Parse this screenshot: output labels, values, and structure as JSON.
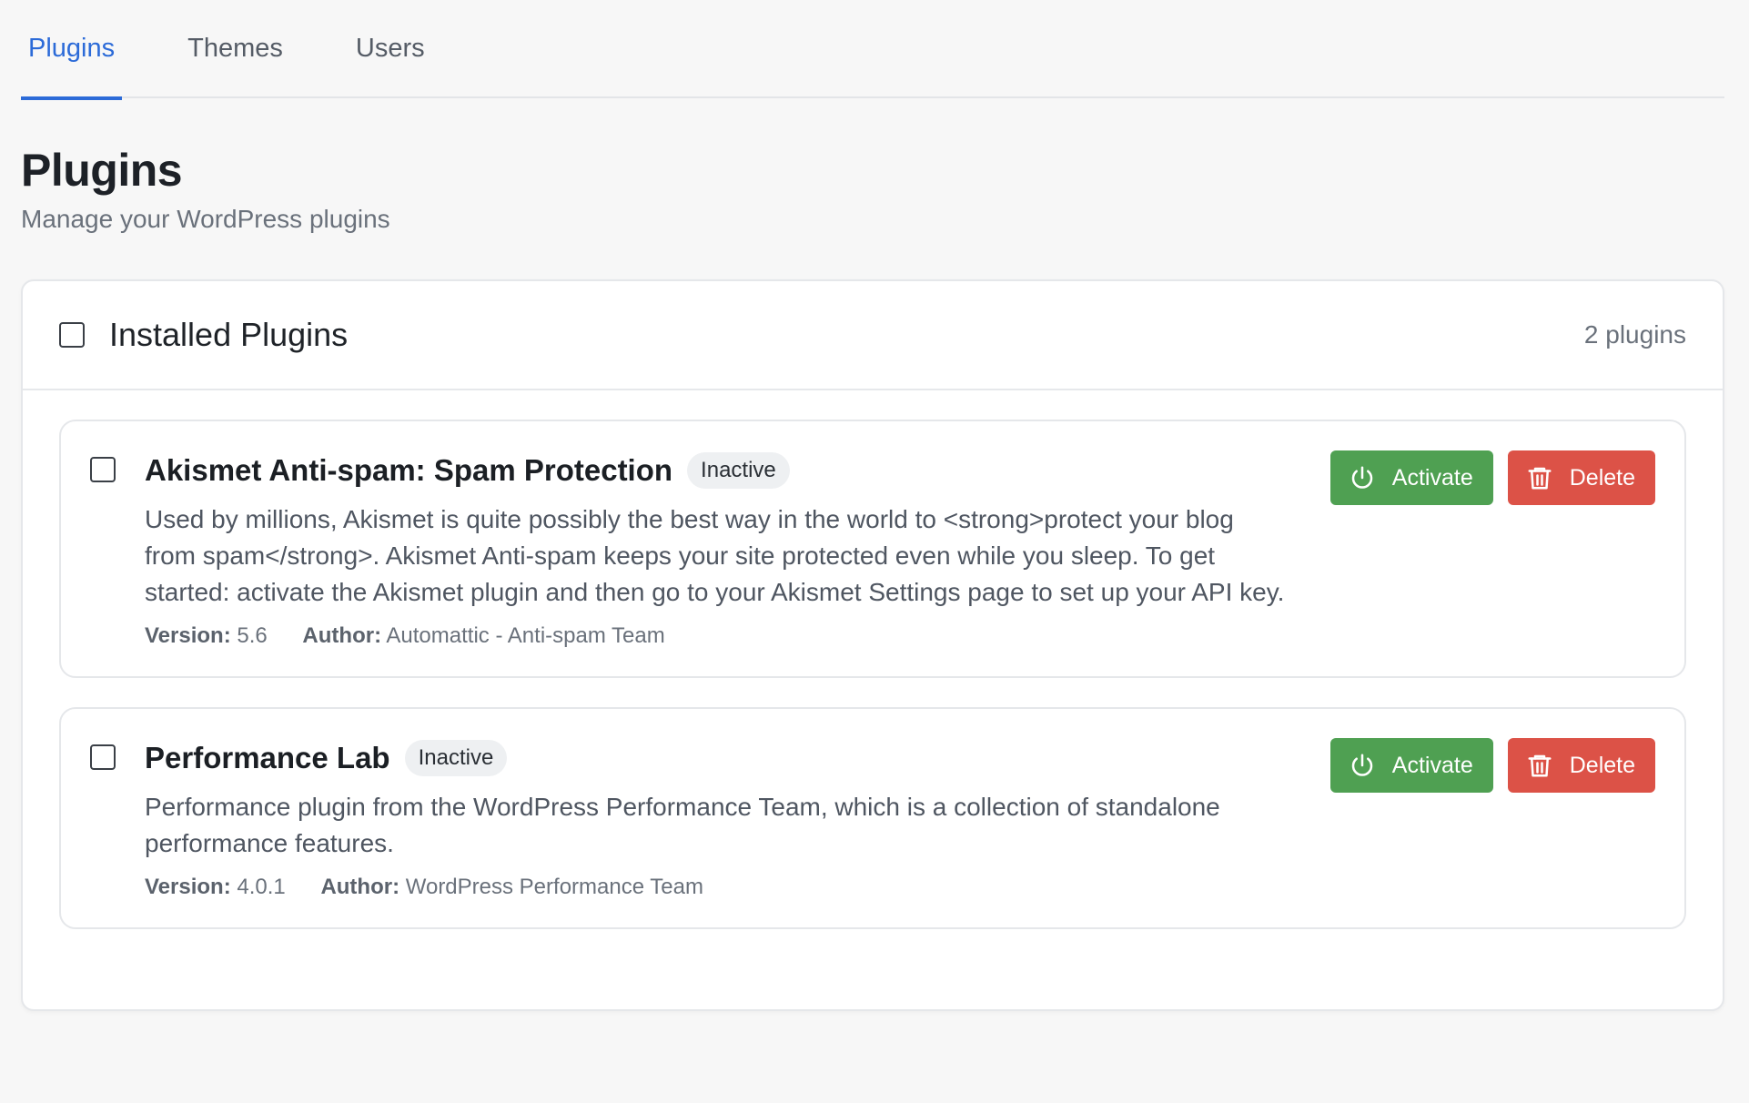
{
  "tabs": [
    {
      "label": "Plugins",
      "active": true
    },
    {
      "label": "Themes",
      "active": false
    },
    {
      "label": "Users",
      "active": false
    }
  ],
  "header": {
    "title": "Plugins",
    "subtitle": "Manage your WordPress plugins"
  },
  "card": {
    "title": "Installed Plugins",
    "count": "2 plugins"
  },
  "labels": {
    "version": "Version:",
    "author": "Author:",
    "activate": "Activate",
    "delete": "Delete"
  },
  "plugins": [
    {
      "name": "Akismet Anti-spam: Spam Protection",
      "status": "Inactive",
      "description": "Used by millions, Akismet is quite possibly the best way in the world to <strong>protect your blog from spam</strong>. Akismet Anti-spam keeps your site protected even while you sleep. To get started: activate the Akismet plugin and then go to your Akismet Settings page to set up your API key.",
      "version": "5.6",
      "author": "Automattic - Anti-spam Team"
    },
    {
      "name": "Performance Lab",
      "status": "Inactive",
      "description": "Performance plugin from the WordPress Performance Team, which is a collection of standalone performance features.",
      "version": "4.0.1",
      "author": "WordPress Performance Team"
    }
  ],
  "colors": {
    "accent": "#2c6bd8",
    "activate": "#4fa052",
    "delete": "#dc5247"
  },
  "icons": {
    "activate": "power-icon",
    "delete": "trash-icon"
  }
}
